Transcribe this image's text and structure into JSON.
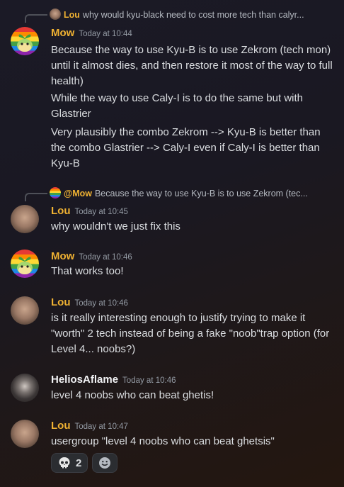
{
  "messages": [
    {
      "reply": {
        "name": "Lou",
        "text": "why would kyu-black need to cost more tech than calyr..."
      },
      "author": "Mow",
      "timestamp": "Today at 10:44",
      "lines": [
        "Because the way to use Kyu-B is to use Zekrom (tech mon) until it almost dies, and then restore it most of the way to full health)",
        "While the way to use Caly-I is to do the same but with Glastrier",
        "Very plausibly the combo Zekrom --> Kyu-B is better than the combo Glastrier --> Caly-I even if Caly-I is better than Kyu-B"
      ]
    },
    {
      "reply": {
        "name": "@Mow",
        "text": "Because the way to use Kyu-B is to use Zekrom (tec..."
      },
      "author": "Lou",
      "timestamp": "Today at 10:45",
      "lines": [
        "why wouldn't we just fix this"
      ]
    },
    {
      "author": "Mow",
      "timestamp": "Today at 10:46",
      "lines": [
        "That works too!"
      ]
    },
    {
      "author": "Lou",
      "timestamp": "Today at 10:46",
      "lines": [
        "is it really interesting enough to justify trying to make it \"worth\" 2 tech instead of being a fake \"noob\"trap option (for Level 4... noobs?)"
      ]
    },
    {
      "author": "HeliosAflame",
      "timestamp": "Today at 10:46",
      "lines": [
        "level 4 noobs who can beat ghetis!"
      ]
    },
    {
      "author": "Lou",
      "timestamp": "Today at 10:47",
      "lines": [
        "usergroup \"level 4 noobs who can beat ghetsis\""
      ]
    }
  ],
  "reactions": [
    {
      "icon": "skull-emoji",
      "count": "2"
    }
  ],
  "colors": {
    "mow_name": "#f0b232",
    "lou_name": "#f0b232",
    "helios_name": "#f2f3f5",
    "text": "#dbdee1",
    "timestamp": "#949ba4"
  }
}
